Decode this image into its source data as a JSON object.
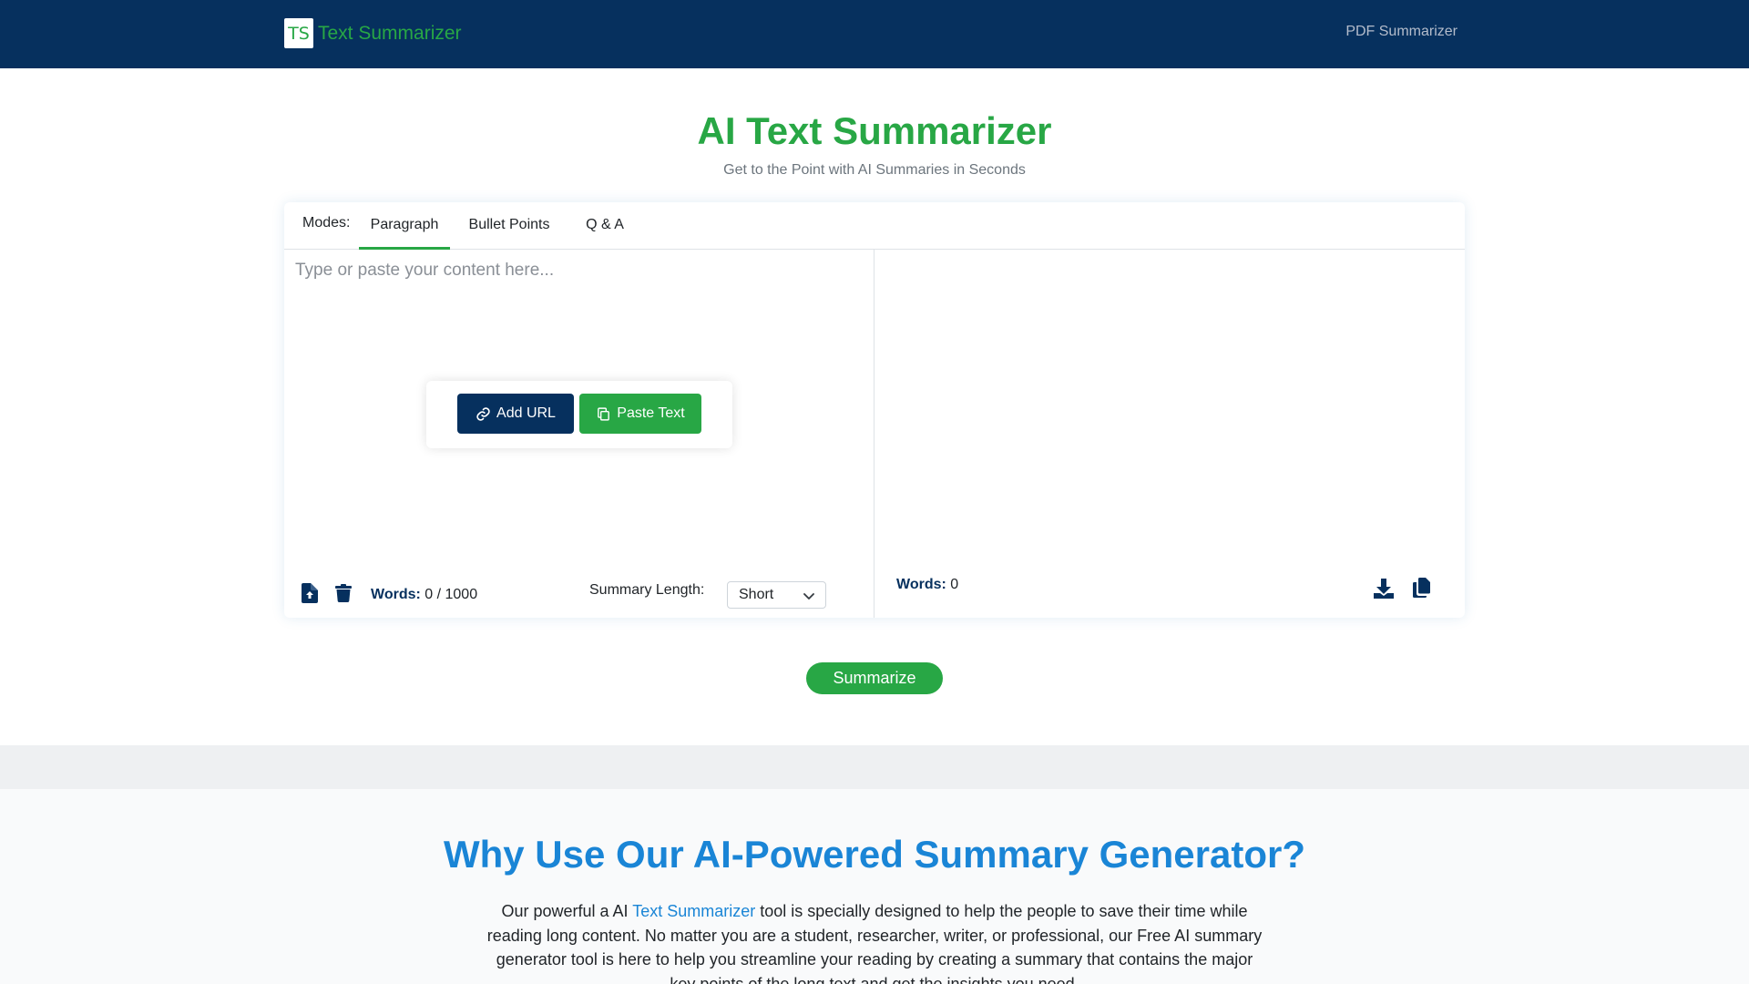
{
  "nav": {
    "logo_text": "TS",
    "brand": "Text Summarizer",
    "link": "PDF Summarizer"
  },
  "hero": {
    "title": "AI Text Summarizer",
    "subtitle": "Get to the Point with AI Summaries in Seconds"
  },
  "modes": {
    "label": "Modes:",
    "tabs": [
      "Paragraph",
      "Bullet Points",
      "Q & A"
    ],
    "active": "Paragraph"
  },
  "input": {
    "placeholder": "Type or paste your content here...",
    "add_url": "Add URL",
    "paste_text": "Paste Text",
    "words_label": "Words:",
    "words_count": "0 / 1000",
    "length_label": "Summary Length:",
    "length_value": "Short"
  },
  "output": {
    "words_label": "Words:",
    "words_count": "0"
  },
  "actions": {
    "summarize": "Summarize"
  },
  "why": {
    "title": "Why Use Our AI-Powered Summary Generator?",
    "text_before": "Our powerful a AI ",
    "link_text": "Text Summarizer",
    "text_after": " tool is specially designed to help the people to save their time while reading long content. No matter you are a student, researcher, writer, or professional, our Free AI summary generator tool is here to help you streamline your reading by creating a summary that contains the major key points of the long text and get the insights you need."
  },
  "colors": {
    "navy": "#06305e",
    "green": "#28a745",
    "blue": "#1a85d6"
  },
  "icons": [
    "link-icon",
    "copy-icon",
    "file-upload-icon",
    "trash-icon",
    "chevron-down-icon",
    "download-icon",
    "copy-files-icon"
  ]
}
